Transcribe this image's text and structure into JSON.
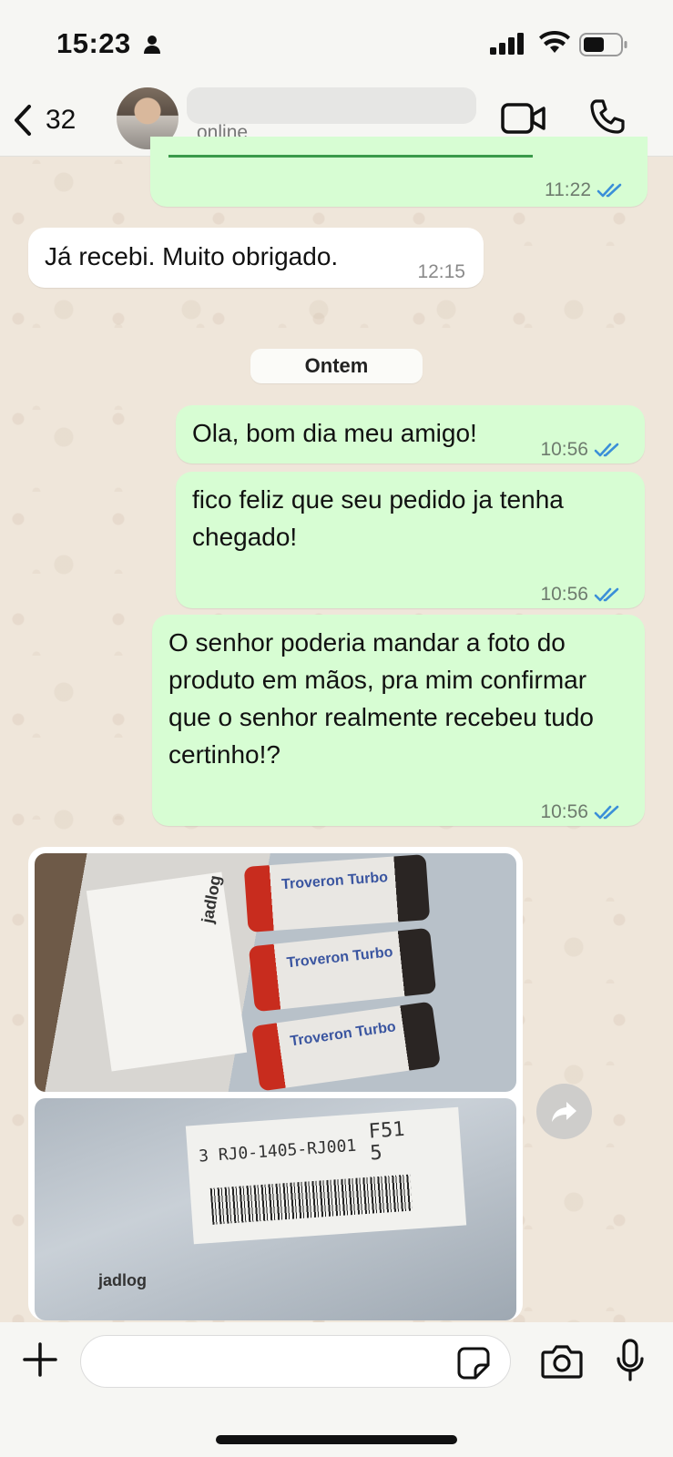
{
  "status_bar": {
    "time": "15:23"
  },
  "header": {
    "back_count": "32",
    "contact_status": "online"
  },
  "messages": [
    {
      "direction": "out",
      "text": "",
      "time": "11:22"
    },
    {
      "direction": "in",
      "text": "Já recebi. Muito obrigado.",
      "time": "12:15"
    },
    {
      "direction": "out",
      "text": "Ola, bom dia meu amigo!",
      "time": "10:56"
    },
    {
      "direction": "out",
      "text": "fico feliz que seu pedido ja tenha chegado!",
      "time": "10:56"
    },
    {
      "direction": "out",
      "text": "O senhor poderia mandar a foto do produto em mãos, pra mim confirmar que o senhor realmente recebeu tudo certinho!?",
      "time": "10:56"
    }
  ],
  "date_divider": "Ontem",
  "image_message": {
    "photo_1": {
      "brand": "jadlog",
      "bottle_label": "Troveron Turbo"
    },
    "photo_2": {
      "brand": "jadlog",
      "code_1": "3 RJ0-1405-RJ001",
      "code_2": "F51",
      "code_3": "5"
    }
  },
  "colors": {
    "outgoing_bubble": "#d7fdd3",
    "incoming_bubble": "#ffffff",
    "read_ticks": "#3b8fd8"
  }
}
